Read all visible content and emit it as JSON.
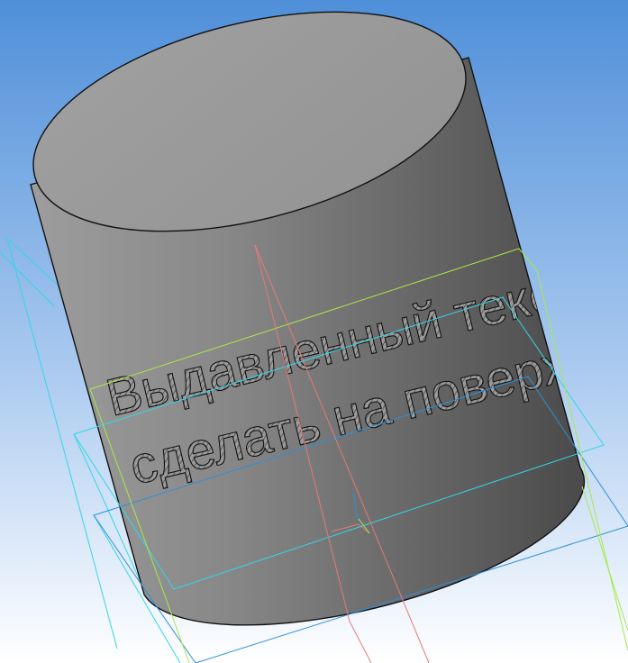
{
  "viewport": {
    "background_top": "#4f8fd9",
    "background_bottom": "#ffffff"
  },
  "model": {
    "body_light": "#9b9b9b",
    "body_dark": "#4c4c4c",
    "top_face": "#9a9a9a",
    "edge_color": "#111111",
    "text_line_1": "Выдавленный текст",
    "text_line_2": "сделать на поверх"
  },
  "construction": {
    "plane_color": "#33d6e6",
    "plane_inner_color": "#2d8fd8",
    "axis_color": "#e67a7a",
    "frame_color": "#a8e84a"
  }
}
